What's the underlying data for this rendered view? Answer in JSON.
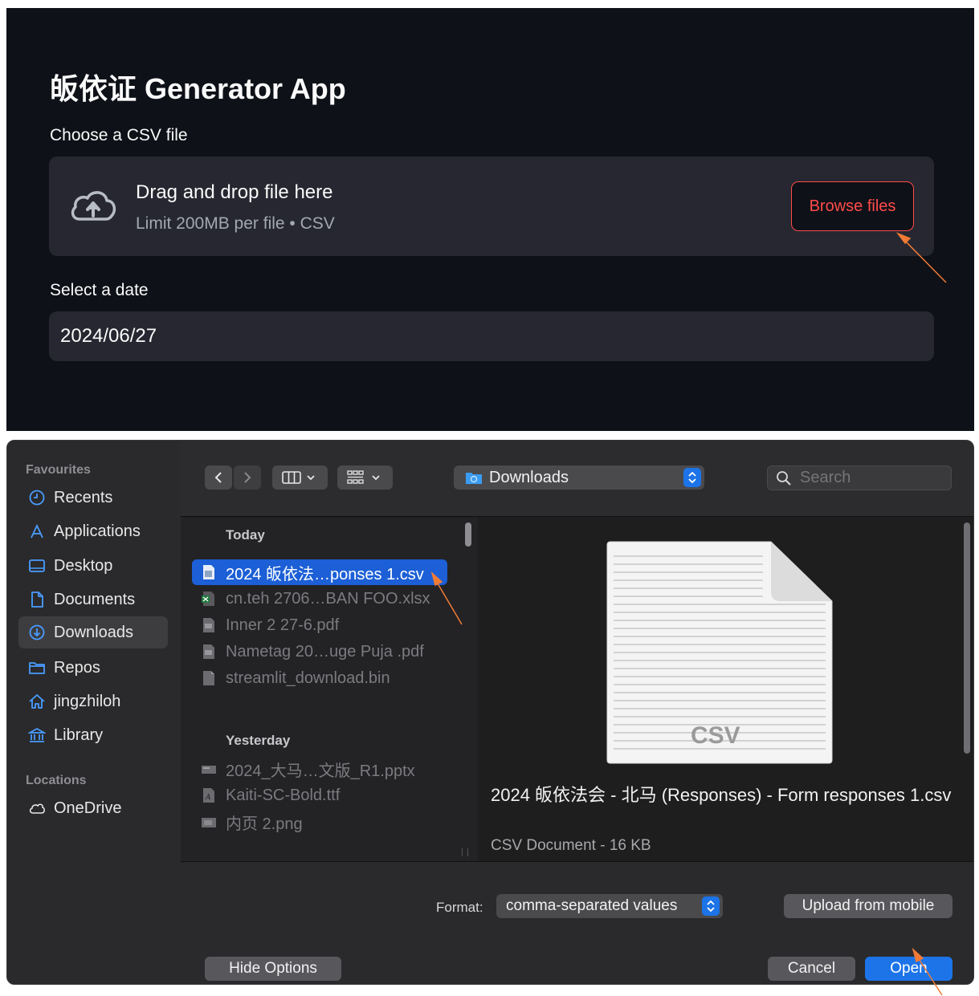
{
  "app": {
    "title": "皈依证 Generator App",
    "csv_label": "Choose a CSV file",
    "dropzone": {
      "title": "Drag and drop file here",
      "subtitle": "Limit 200MB per file • CSV",
      "browse_label": "Browse files"
    },
    "date_label": "Select a date",
    "date_value": "2024/06/27"
  },
  "dialog": {
    "sidebar": {
      "favourites_heading": "Favourites",
      "favourites": [
        {
          "label": "Recents",
          "icon": "clock-icon"
        },
        {
          "label": "Applications",
          "icon": "applications-icon"
        },
        {
          "label": "Desktop",
          "icon": "desktop-icon"
        },
        {
          "label": "Documents",
          "icon": "document-icon"
        },
        {
          "label": "Downloads",
          "icon": "download-icon",
          "active": true
        },
        {
          "label": "Repos",
          "icon": "folder-icon"
        },
        {
          "label": "jingzhiloh",
          "icon": "home-icon"
        },
        {
          "label": "Library",
          "icon": "library-icon"
        }
      ],
      "locations_heading": "Locations",
      "locations": [
        {
          "label": "OneDrive",
          "icon": "cloud-icon"
        }
      ]
    },
    "toolbar": {
      "location": "Downloads",
      "search_placeholder": "Search"
    },
    "files": {
      "today_heading": "Today",
      "today": [
        {
          "name": "2024 皈依法…ponses 1.csv",
          "selected": true
        },
        {
          "name": "cn.teh 2706…BAN FOO.xlsx"
        },
        {
          "name": "Inner 2  27-6.pdf"
        },
        {
          "name": "Nametag 20…uge Puja .pdf"
        },
        {
          "name": "streamlit_download.bin"
        }
      ],
      "yesterday_heading": "Yesterday",
      "yesterday": [
        {
          "name": "2024_大马…文版_R1.pptx"
        },
        {
          "name": "Kaiti-SC-Bold.ttf"
        },
        {
          "name": "内页 2.png"
        }
      ]
    },
    "preview": {
      "badge": "CSV",
      "filename": "2024 皈依法会 - 北马 (Responses) - Form responses 1.csv",
      "kind": "CSV Document - 16 KB"
    },
    "bottom": {
      "format_label": "Format:",
      "format_value": "comma-separated values",
      "upload_label": "Upload from mobile",
      "hide_options_label": "Hide Options",
      "cancel_label": "Cancel",
      "open_label": "Open"
    }
  },
  "colors": {
    "app_bg": "#0e1117",
    "app_panel": "#262730",
    "accent_red": "#ff4b4b",
    "selection_blue": "#1c5fd6",
    "open_blue": "#1c74e8",
    "annotation_arrow": "#f07a36"
  }
}
